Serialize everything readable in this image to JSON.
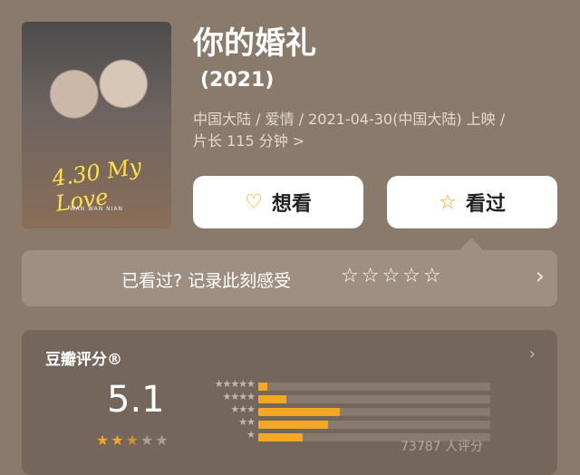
{
  "poster": {
    "alt": "你的婚礼 poster",
    "caption": "WAN WAN NIAN",
    "title_art": "4.30 My Love"
  },
  "movie": {
    "title": "你的婚礼",
    "year": "(2021)",
    "meta_line1": "中国大陆 / 爱情 / 2021-04-30(中国大陆) 上映 /",
    "meta_line2": "片长 115 分钟 >"
  },
  "actions": {
    "want_label": "想看",
    "seen_label": "看过"
  },
  "record": {
    "prompt": "已看过? 记录此刻感受",
    "stars": "☆☆☆☆☆",
    "chevron": "›"
  },
  "rating": {
    "title": "豆瓣评分®",
    "chevron": "›",
    "score": "5.1",
    "stars": {
      "full": 2,
      "half": 1,
      "empty": 2
    },
    "distribution": [
      {
        "label": "★★★★★",
        "percent": 4
      },
      {
        "label": "★★★★",
        "percent": 12
      },
      {
        "label": "★★★",
        "percent": 35
      },
      {
        "label": "★★",
        "percent": 30
      },
      {
        "label": "★",
        "percent": 19
      }
    ],
    "raters": "73787 人评分"
  },
  "colors": {
    "background": "#8a7a6c",
    "accent": "#f5a623",
    "panel": "#74665b"
  }
}
